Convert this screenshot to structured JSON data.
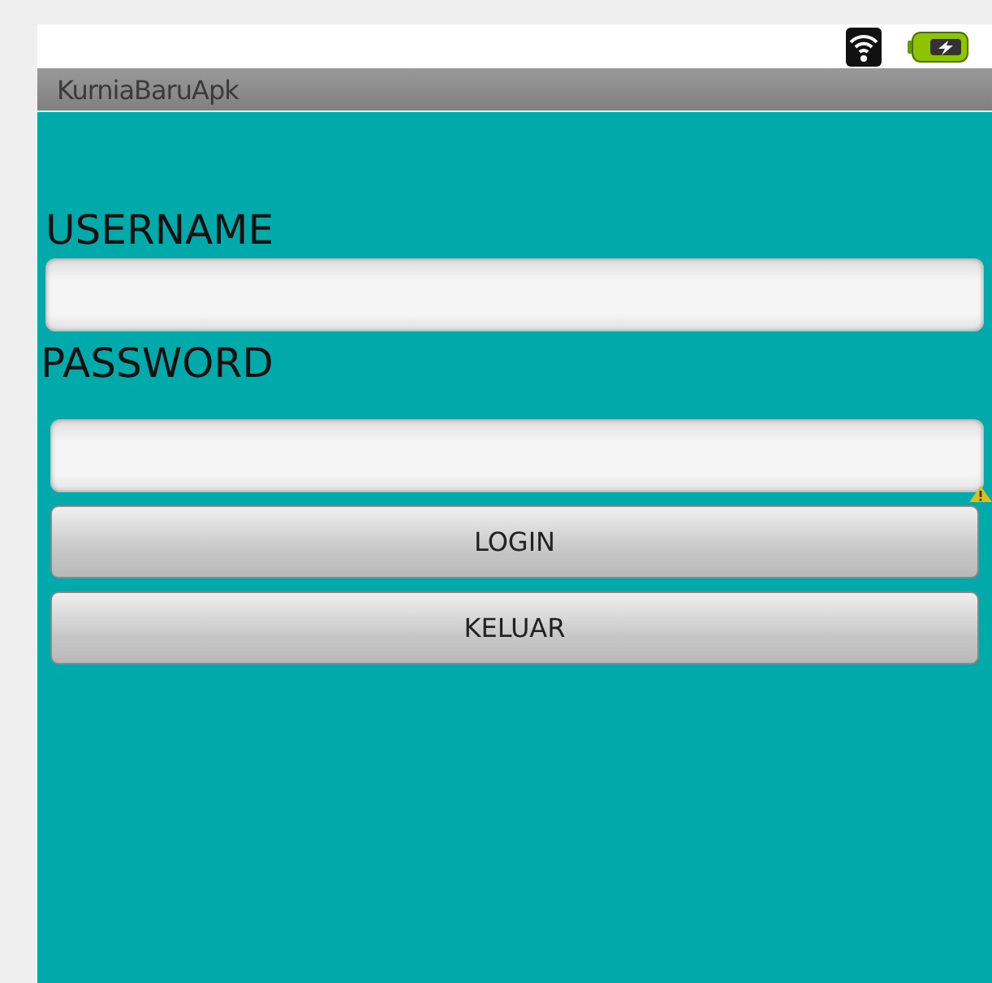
{
  "app_bar": {
    "title": "KurniaBaruApk"
  },
  "form": {
    "fields": [
      {
        "label": "USERNAME",
        "kind": "text"
      },
      {
        "label": "PASSWORD",
        "kind": "password"
      }
    ],
    "buttons": [
      "LOGIN",
      "KELUAR"
    ]
  }
}
